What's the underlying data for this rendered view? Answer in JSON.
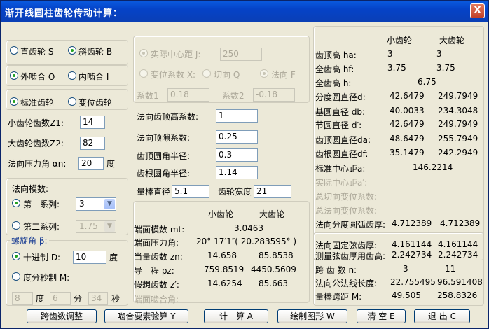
{
  "title": "渐开线圆柱齿轮传动计算：",
  "close": "X",
  "left": {
    "gear_type": {
      "straight": "直齿轮 S",
      "helical": "斜齿轮 B",
      "selected": "helical"
    },
    "mesh": {
      "external": "外啮合 O",
      "internal": "内啮合 I",
      "selected": "external"
    },
    "profile": {
      "standard": "标准齿轮",
      "modified": "变位齿轮",
      "selected": "standard"
    },
    "z1_label": "小齿轮齿数Z1:",
    "z1": "14",
    "z2_label": "大齿轮齿数Z2:",
    "z2": "82",
    "alpha_label": "法向压力角 αn:",
    "alpha": "20",
    "alpha_unit": "度",
    "module_title": "法向模数:",
    "series1": "第一系列:",
    "series1_value": "3",
    "series2": "第二系列:",
    "series2_value": "1.75",
    "helix_title": "螺旋角 β:",
    "decimal": "十进制 D:",
    "decimal_value": "10",
    "decimal_unit": "度",
    "dms": "度分秒制 M:",
    "deg": "8",
    "deg_unit": "度",
    "min": "6",
    "min_unit": "分",
    "sec": "34",
    "sec_unit": "秒"
  },
  "middle": {
    "actual_cd": "实际中心距 J:",
    "actual_cd_value": "250",
    "shift_coef": "变位系数 X:",
    "tangential": "切向 Q",
    "normal": "法向 F",
    "coef1": "系数1",
    "coef1_value": "0.18",
    "coef2": "系数2",
    "coef2_value": "-0.18",
    "addendum_coef": "法向齿顶高系数:",
    "addendum_coef_value": "1",
    "clearance_coef": "法向顶隙系数:",
    "clearance_coef_value": "0.25",
    "tip_radius": "齿顶圆角半径:",
    "tip_radius_value": "0.3",
    "root_radius": "齿根圆角半径:",
    "root_radius_value": "1.14",
    "pin_dia": "量棒直径",
    "pin_dia_value": "5.1",
    "face_width": "齿轮宽度",
    "face_width_value": "21",
    "hdr_small": "小齿轮",
    "hdr_large": "大齿轮",
    "mt_label": "端面模数 mt:",
    "mt": "3.0463",
    "at_label": "端面压力角:",
    "at": "20° 17′1″( 20.283595° )",
    "zn_label": "当量齿数 zn:",
    "zn1": "14.658",
    "zn2": "85.8538",
    "pz_label": "导　程 pz:",
    "pz1": "759.8519",
    "pz2": "4450.5609",
    "zv_label": "假想齿数 z′:",
    "zv1": "14.6254",
    "zv2": "85.663",
    "transverse_mesh": "端面啮合角:"
  },
  "right": {
    "hdr_small": "小齿轮",
    "hdr_large": "大齿轮",
    "rows": [
      {
        "label": "齿顶高 ha:",
        "v1": "3",
        "v2": "3"
      },
      {
        "label": "全齿高 hf:",
        "v1": "3.75",
        "v2": "3.75"
      },
      {
        "label": "全齿高 h:",
        "v1": "6.75",
        "v2": ""
      },
      {
        "label": "分度圆直径d:",
        "v1": "42.6479",
        "v2": "249.7949"
      },
      {
        "label": "基圆直径 db:",
        "v1": "40.0033",
        "v2": "234.3048"
      },
      {
        "label": "节圆直径 d′:",
        "v1": "42.6479",
        "v2": "249.7949"
      },
      {
        "label": "齿顶圆直径da:",
        "v1": "48.6479",
        "v2": "255.7949"
      },
      {
        "label": "齿根圆直径df:",
        "v1": "35.1479",
        "v2": "242.2949"
      }
    ],
    "center_label": "标准中心距a:",
    "center": "146.2214",
    "actual_cd_label": "实际中心距a′:",
    "sum_tan_label": "总切向变位系数:",
    "sum_norm_label": "总法向变位系数:",
    "arc_label": "法向分度圆弧齿厚:",
    "arc1": "4.712389",
    "arc2": "4.712389",
    "fixed_label": "法向固定弦齿厚:",
    "fixed1": "4.161144",
    "fixed2": "4.161144",
    "meas_label": "测量弦齿厚用齿高:",
    "meas1": "2.242734",
    "meas2": "2.242734",
    "span_n_label": "跨 齿 数 n:",
    "span_n1": "3",
    "span_n2": "11",
    "span_w_label": "法向公法线长度:",
    "span_w1": "22.755495",
    "span_w2": "96.591408",
    "pin_m_label": "量棒跨距 M:",
    "pin_m1": "49.505",
    "pin_m2": "258.8326"
  },
  "buttons": {
    "span_adjust": "跨齿数调整",
    "check": "啮合要素验算 Y",
    "calc": "计　算 A",
    "draw": "绘制图形 W",
    "clear": "清 空 E",
    "exit": "退 出 C"
  }
}
